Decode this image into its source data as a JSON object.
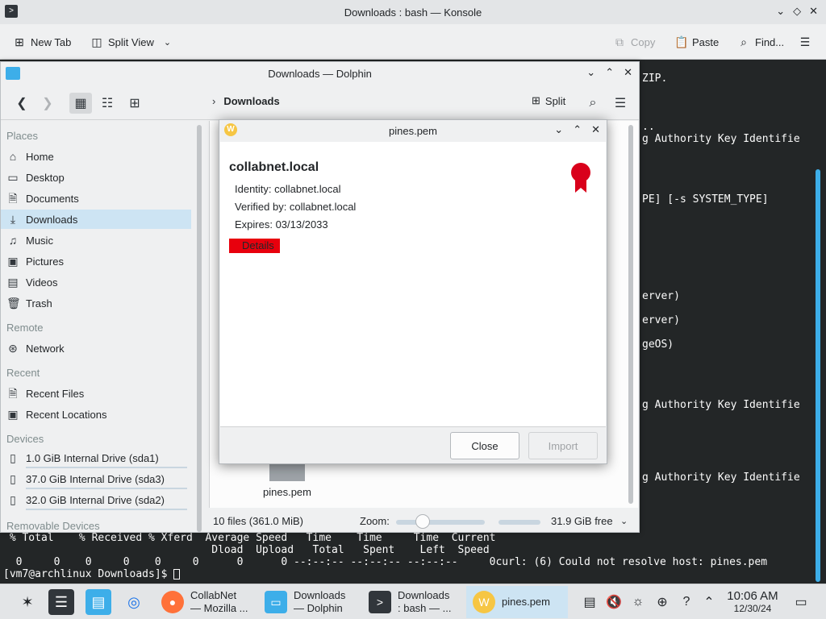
{
  "konsole": {
    "title": "Downloads : bash — Konsole",
    "toolbar": {
      "new_tab": "New Tab",
      "split_view": "Split View",
      "copy": "Copy",
      "paste": "Paste",
      "find": "Find..."
    },
    "terminal_lines": [
      "ZIP.",
      "..",
      "g Authority Key Identifie",
      "PE] [-s SYSTEM_TYPE]",
      "erver)",
      "erver)",
      "geOS)",
      "g Authority Key Identifie",
      "g Authority Key Identifie"
    ],
    "curl_header_1": " % Total    % Received % Xferd  Average Speed   Time    Time     Time  Current",
    "curl_header_2": "                                 Dload  Upload   Total   Spent    Left  Speed",
    "curl_progress": "  0     0    0     0    0     0      0      0 --:--:-- --:--:-- --:--:--     0curl: (6) Could not resolve host: pines.pem",
    "prompt": "[vm7@archlinux Downloads]$ "
  },
  "dolphin": {
    "title": "Downloads — Dolphin",
    "breadcrumb": "Downloads",
    "split": "Split",
    "sections": {
      "places": "Places",
      "remote": "Remote",
      "recent": "Recent",
      "devices": "Devices",
      "removable": "Removable Devices"
    },
    "places": [
      {
        "label": "Home",
        "icon": "home-icon"
      },
      {
        "label": "Desktop",
        "icon": "desktop-icon"
      },
      {
        "label": "Documents",
        "icon": "documents-icon"
      },
      {
        "label": "Downloads",
        "icon": "downloads-icon",
        "selected": true
      },
      {
        "label": "Music",
        "icon": "music-icon"
      },
      {
        "label": "Pictures",
        "icon": "pictures-icon"
      },
      {
        "label": "Videos",
        "icon": "videos-icon"
      },
      {
        "label": "Trash",
        "icon": "trash-icon"
      }
    ],
    "remote": [
      {
        "label": "Network",
        "icon": "network-icon"
      }
    ],
    "recent": [
      {
        "label": "Recent Files",
        "icon": "recent-files-icon"
      },
      {
        "label": "Recent Locations",
        "icon": "recent-locations-icon"
      }
    ],
    "devices": [
      {
        "label": "1.0 GiB Internal Drive (sda1)",
        "icon": "drive-icon"
      },
      {
        "label": "37.0 GiB Internal Drive (sda3)",
        "icon": "drive-icon"
      },
      {
        "label": "32.0 GiB Internal Drive (sda2)",
        "icon": "drive-icon"
      }
    ],
    "file_name": "pines.pem",
    "status_count": "10 files (361.0 MiB)",
    "zoom_label": "Zoom:",
    "free_space": "31.9 GiB free"
  },
  "dialog": {
    "title": "pines.pem",
    "cert_name": "collabnet.local",
    "identity": "Identity: collabnet.local",
    "verified_by": "Verified by: collabnet.local",
    "expires": "Expires: 03/13/2033",
    "details": "Details",
    "close": "Close",
    "import": "Import"
  },
  "taskbar": {
    "tasks": [
      {
        "line1": "CollabNet",
        "line2": "— Mozilla ..."
      },
      {
        "line1": "Downloads",
        "line2": "— Dolphin"
      },
      {
        "line1": "Downloads",
        "line2": ": bash — ..."
      },
      {
        "line1": "pines.pem",
        "line2": ""
      }
    ],
    "time": "10:06 AM",
    "date": "12/30/24"
  },
  "colors": {
    "accent": "#3daee9",
    "selection": "#cde4f3",
    "details_highlight": "#e8000d",
    "seal": "#d9001b",
    "terminal_bg": "#232627"
  }
}
